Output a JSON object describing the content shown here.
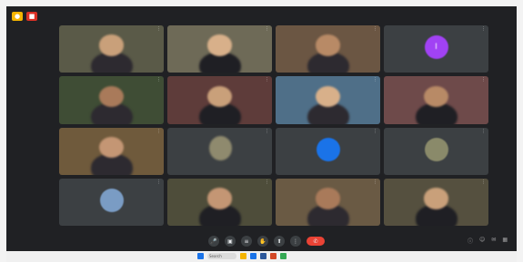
{
  "window": {
    "top_buttons": [
      {
        "icon": "record-icon",
        "color": "#f4b400"
      },
      {
        "icon": "stop-icon",
        "color": "#d93025"
      }
    ]
  },
  "tiles": [
    {
      "label": "",
      "avatar": "",
      "bg": "#5a5a48"
    },
    {
      "label": "",
      "avatar": "",
      "bg": "#6e6a57"
    },
    {
      "label": "",
      "avatar": "",
      "bg": "#6b5643"
    },
    {
      "label": "",
      "avatar": "I",
      "bg": "#3c4043",
      "avatar_color": "#a142f4"
    },
    {
      "label": "",
      "avatar": "",
      "bg": "#3f4d35"
    },
    {
      "label": "",
      "avatar": "",
      "bg": "#5e3c3a"
    },
    {
      "label": "",
      "avatar": "",
      "bg": "#4f6f88"
    },
    {
      "label": "",
      "avatar": "",
      "bg": "#6e4a4a"
    },
    {
      "label": "",
      "avatar": "",
      "bg": "#6f5a3c"
    },
    {
      "label": "",
      "avatar": "",
      "bg": "#3c4043"
    },
    {
      "label": "",
      "avatar": "",
      "bg": "#3c4043",
      "avatar_color": "#1a73e8"
    },
    {
      "label": "",
      "avatar": "",
      "bg": "#3c4043",
      "avatar_color": "#8a8a6a"
    },
    {
      "label": "",
      "avatar": "",
      "bg": "#3c4043",
      "avatar_color": "#7a9cc4"
    },
    {
      "label": "",
      "avatar": "",
      "bg": "#4e4d3a"
    },
    {
      "label": "",
      "avatar": "",
      "bg": "#6a5a44"
    },
    {
      "label": "",
      "avatar": "",
      "bg": "#55503f"
    }
  ],
  "bottom": {
    "info": "",
    "controls": [
      {
        "icon": "mic-icon"
      },
      {
        "icon": "camera-icon"
      },
      {
        "icon": "captions-icon"
      },
      {
        "icon": "raise-hand-icon"
      },
      {
        "icon": "present-icon"
      },
      {
        "icon": "more-options-icon"
      },
      {
        "icon": "end-call-icon",
        "color": "#ea4335"
      }
    ],
    "right_controls": [
      {
        "icon": "info-icon"
      },
      {
        "icon": "people-icon"
      },
      {
        "icon": "chat-icon"
      },
      {
        "icon": "activities-icon"
      }
    ]
  },
  "taskbar": {
    "search_placeholder": "Search",
    "apps": [
      {
        "icon": "start-icon",
        "color": "#1a73e8"
      },
      {
        "icon": "file-explorer-icon",
        "color": "#f4b400"
      },
      {
        "icon": "edge-icon",
        "color": "#1a73e8"
      },
      {
        "icon": "word-icon",
        "color": "#2b579a"
      },
      {
        "icon": "powerpoint-icon",
        "color": "#d24726"
      },
      {
        "icon": "chrome-icon",
        "color": "#34a853"
      }
    ],
    "tray_text": ""
  }
}
